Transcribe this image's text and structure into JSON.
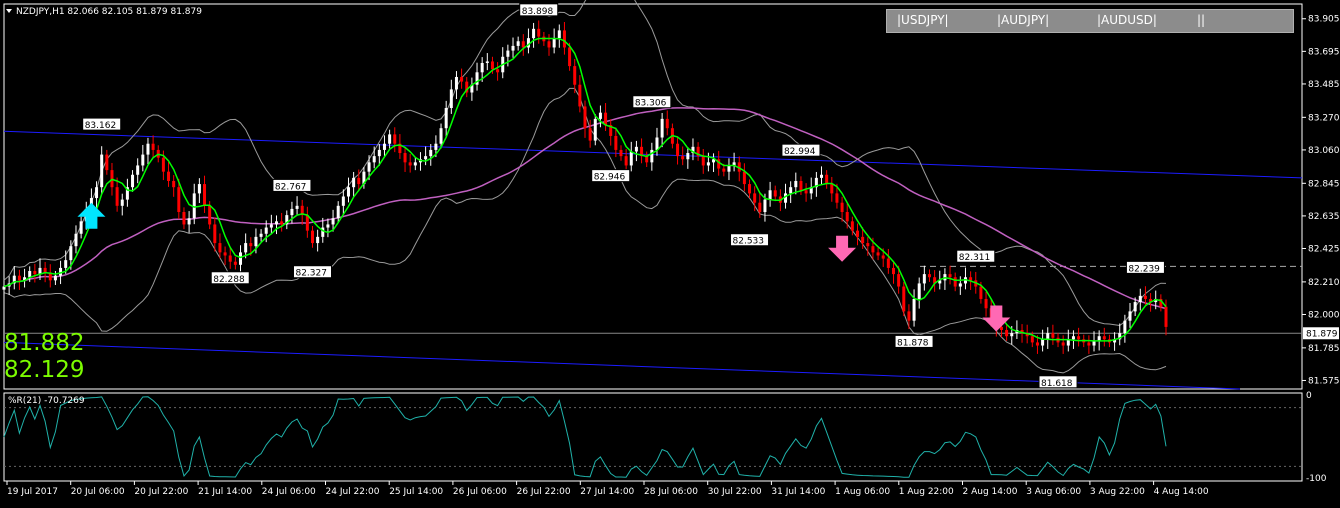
{
  "header": {
    "title": "NZDJPY,H1",
    "ohlc": "82.066 82.105 81.879 81.879"
  },
  "symbol_bar": [
    "|USDJPY|",
    "|AUDJPY|",
    "|AUDUSD|",
    "||"
  ],
  "big_prices": {
    "bid": "81.882",
    "ask": "82.129"
  },
  "indicator": {
    "label": "%R(21) -70.7269",
    "level_top": "0",
    "level_bottom": "-100"
  },
  "chart_data": {
    "type": "candlestick",
    "ylim": [
      81.52,
      84.0
    ],
    "y_ticks": [
      "83.905",
      "83.695",
      "83.485",
      "83.270",
      "83.060",
      "82.845",
      "82.635",
      "82.425",
      "82.210",
      "82.000",
      "81.785",
      "81.575"
    ],
    "current_price": "81.879",
    "x_ticks": [
      "19 Jul 2017",
      "20 Jul 06:00",
      "20 Jul 22:00",
      "21 Jul 14:00",
      "24 Jul 06:00",
      "24 Jul 22:00",
      "25 Jul 14:00",
      "26 Jul 06:00",
      "26 Jul 22:00",
      "27 Jul 14:00",
      "28 Jul 06:00",
      "30 Jul 22:00",
      "31 Jul 14:00",
      "1 Aug 06:00",
      "1 Aug 22:00",
      "2 Aug 14:00",
      "3 Aug 06:00",
      "3 Aug 22:00",
      "4 Aug 14:00"
    ],
    "swing_labels": [
      {
        "text": "83.162",
        "bar": 19,
        "value": 83.162,
        "pos": "above"
      },
      {
        "text": "82.288",
        "bar": 44,
        "value": 82.288,
        "pos": "below"
      },
      {
        "text": "82.767",
        "bar": 56,
        "value": 82.767,
        "pos": "above"
      },
      {
        "text": "82.327",
        "bar": 60,
        "value": 82.327,
        "pos": "below"
      },
      {
        "text": "83.898",
        "bar": 104,
        "value": 83.898,
        "pos": "above"
      },
      {
        "text": "83.306",
        "bar": 126,
        "value": 83.306,
        "pos": "above"
      },
      {
        "text": "82.946",
        "bar": 118,
        "value": 82.946,
        "pos": "below"
      },
      {
        "text": "82.994",
        "bar": 155,
        "value": 82.994,
        "pos": "above"
      },
      {
        "text": "82.533",
        "bar": 145,
        "value": 82.533,
        "pos": "below"
      },
      {
        "text": "82.311",
        "bar": 189,
        "value": 82.311,
        "pos": "above"
      },
      {
        "text": "81.878",
        "bar": 177,
        "value": 81.878,
        "pos": "below"
      },
      {
        "text": "81.618",
        "bar": 205,
        "value": 81.618,
        "pos": "below"
      },
      {
        "text": "82.239",
        "bar": 222,
        "value": 82.239,
        "pos": "above"
      }
    ],
    "series": [
      {
        "name": "close",
        "values": [
          82.18,
          82.2,
          82.25,
          82.22,
          82.24,
          82.28,
          82.26,
          82.3,
          82.27,
          82.22,
          82.25,
          82.3,
          82.35,
          82.44,
          82.52,
          82.6,
          82.68,
          82.75,
          82.82,
          83.03,
          82.93,
          82.82,
          82.7,
          82.74,
          82.82,
          82.9,
          82.96,
          83.03,
          83.1,
          83.06,
          83.01,
          82.92,
          82.86,
          82.82,
          82.66,
          82.58,
          82.62,
          82.78,
          82.84,
          82.7,
          82.58,
          82.46,
          82.4,
          82.38,
          82.34,
          82.32,
          82.4,
          82.46,
          82.44,
          82.5,
          82.52,
          82.56,
          82.58,
          82.6,
          82.58,
          82.64,
          82.68,
          82.7,
          82.64,
          82.54,
          82.46,
          82.5,
          82.56,
          82.58,
          82.62,
          82.7,
          82.76,
          82.82,
          82.88,
          82.84,
          82.92,
          82.98,
          83.02,
          83.06,
          83.1,
          83.16,
          83.1,
          83.04,
          82.98,
          82.96,
          82.98,
          83.0,
          83.02,
          83.06,
          83.1,
          83.2,
          83.33,
          83.45,
          83.53,
          83.5,
          83.43,
          83.48,
          83.56,
          83.62,
          83.63,
          83.58,
          83.56,
          83.66,
          83.7,
          83.73,
          83.76,
          83.72,
          83.78,
          83.84,
          83.79,
          83.76,
          83.72,
          83.78,
          83.83,
          83.72,
          83.6,
          83.48,
          83.34,
          83.2,
          83.12,
          83.26,
          83.3,
          83.22,
          83.15,
          83.06,
          83.02,
          82.96,
          83.05,
          83.08,
          83.02,
          82.98,
          83.06,
          83.14,
          83.26,
          83.2,
          83.1,
          83.02,
          83.0,
          83.04,
          83.08,
          83.02,
          82.96,
          82.98,
          83.0,
          82.94,
          82.92,
          82.96,
          82.98,
          82.92,
          82.84,
          82.78,
          82.72,
          82.66,
          82.74,
          82.8,
          82.76,
          82.72,
          82.78,
          82.82,
          82.86,
          82.8,
          82.78,
          82.82,
          82.88,
          82.9,
          82.84,
          82.78,
          82.72,
          82.66,
          82.6,
          82.54,
          82.5,
          82.46,
          82.44,
          82.4,
          82.38,
          82.36,
          82.3,
          82.26,
          82.18,
          82.02,
          81.96,
          82.1,
          82.2,
          82.26,
          82.24,
          82.2,
          82.22,
          82.26,
          82.24,
          82.18,
          82.2,
          82.24,
          82.22,
          82.18,
          82.1,
          82.04,
          81.96,
          81.92,
          81.9,
          81.86,
          81.88,
          81.9,
          81.88,
          81.86,
          81.82,
          81.8,
          81.84,
          81.88,
          81.85,
          81.82,
          81.8,
          81.84,
          81.86,
          81.84,
          81.82,
          81.8,
          81.83,
          81.86,
          81.84,
          81.82,
          81.84,
          81.88,
          81.96,
          82.02,
          82.08,
          82.12,
          82.1,
          82.08,
          82.1,
          82.05,
          81.92
        ]
      }
    ],
    "indicator_levels": [
      0,
      -100
    ]
  },
  "colors": {
    "bull": "#ffffff",
    "bear": "#ff0000",
    "ma_fast": "#00ff00",
    "ma_slow": "#c060c0",
    "bands": "#9a9a9a",
    "channel": "#1c1cff",
    "wpr": "#20b2aa",
    "arrow_up": "#00e5ff",
    "arrow_down": "#ff69b4",
    "big_price": "#7cfc00"
  }
}
